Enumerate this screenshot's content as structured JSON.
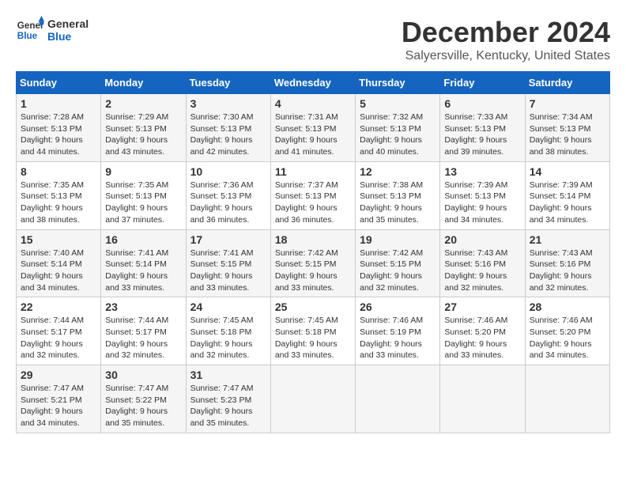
{
  "logo": {
    "line1": "General",
    "line2": "Blue"
  },
  "title": "December 2024",
  "location": "Salyersville, Kentucky, United States",
  "days_of_week": [
    "Sunday",
    "Monday",
    "Tuesday",
    "Wednesday",
    "Thursday",
    "Friday",
    "Saturday"
  ],
  "weeks": [
    [
      {
        "day": "1",
        "sunrise": "7:28 AM",
        "sunset": "5:13 PM",
        "daylight": "9 hours and 44 minutes."
      },
      {
        "day": "2",
        "sunrise": "7:29 AM",
        "sunset": "5:13 PM",
        "daylight": "9 hours and 43 minutes."
      },
      {
        "day": "3",
        "sunrise": "7:30 AM",
        "sunset": "5:13 PM",
        "daylight": "9 hours and 42 minutes."
      },
      {
        "day": "4",
        "sunrise": "7:31 AM",
        "sunset": "5:13 PM",
        "daylight": "9 hours and 41 minutes."
      },
      {
        "day": "5",
        "sunrise": "7:32 AM",
        "sunset": "5:13 PM",
        "daylight": "9 hours and 40 minutes."
      },
      {
        "day": "6",
        "sunrise": "7:33 AM",
        "sunset": "5:13 PM",
        "daylight": "9 hours and 39 minutes."
      },
      {
        "day": "7",
        "sunrise": "7:34 AM",
        "sunset": "5:13 PM",
        "daylight": "9 hours and 38 minutes."
      }
    ],
    [
      {
        "day": "8",
        "sunrise": "7:35 AM",
        "sunset": "5:13 PM",
        "daylight": "9 hours and 38 minutes."
      },
      {
        "day": "9",
        "sunrise": "7:35 AM",
        "sunset": "5:13 PM",
        "daylight": "9 hours and 37 minutes."
      },
      {
        "day": "10",
        "sunrise": "7:36 AM",
        "sunset": "5:13 PM",
        "daylight": "9 hours and 36 minutes."
      },
      {
        "day": "11",
        "sunrise": "7:37 AM",
        "sunset": "5:13 PM",
        "daylight": "9 hours and 36 minutes."
      },
      {
        "day": "12",
        "sunrise": "7:38 AM",
        "sunset": "5:13 PM",
        "daylight": "9 hours and 35 minutes."
      },
      {
        "day": "13",
        "sunrise": "7:39 AM",
        "sunset": "5:13 PM",
        "daylight": "9 hours and 34 minutes."
      },
      {
        "day": "14",
        "sunrise": "7:39 AM",
        "sunset": "5:14 PM",
        "daylight": "9 hours and 34 minutes."
      }
    ],
    [
      {
        "day": "15",
        "sunrise": "7:40 AM",
        "sunset": "5:14 PM",
        "daylight": "9 hours and 34 minutes."
      },
      {
        "day": "16",
        "sunrise": "7:41 AM",
        "sunset": "5:14 PM",
        "daylight": "9 hours and 33 minutes."
      },
      {
        "day": "17",
        "sunrise": "7:41 AM",
        "sunset": "5:15 PM",
        "daylight": "9 hours and 33 minutes."
      },
      {
        "day": "18",
        "sunrise": "7:42 AM",
        "sunset": "5:15 PM",
        "daylight": "9 hours and 33 minutes."
      },
      {
        "day": "19",
        "sunrise": "7:42 AM",
        "sunset": "5:15 PM",
        "daylight": "9 hours and 32 minutes."
      },
      {
        "day": "20",
        "sunrise": "7:43 AM",
        "sunset": "5:16 PM",
        "daylight": "9 hours and 32 minutes."
      },
      {
        "day": "21",
        "sunrise": "7:43 AM",
        "sunset": "5:16 PM",
        "daylight": "9 hours and 32 minutes."
      }
    ],
    [
      {
        "day": "22",
        "sunrise": "7:44 AM",
        "sunset": "5:17 PM",
        "daylight": "9 hours and 32 minutes."
      },
      {
        "day": "23",
        "sunrise": "7:44 AM",
        "sunset": "5:17 PM",
        "daylight": "9 hours and 32 minutes."
      },
      {
        "day": "24",
        "sunrise": "7:45 AM",
        "sunset": "5:18 PM",
        "daylight": "9 hours and 32 minutes."
      },
      {
        "day": "25",
        "sunrise": "7:45 AM",
        "sunset": "5:18 PM",
        "daylight": "9 hours and 33 minutes."
      },
      {
        "day": "26",
        "sunrise": "7:46 AM",
        "sunset": "5:19 PM",
        "daylight": "9 hours and 33 minutes."
      },
      {
        "day": "27",
        "sunrise": "7:46 AM",
        "sunset": "5:20 PM",
        "daylight": "9 hours and 33 minutes."
      },
      {
        "day": "28",
        "sunrise": "7:46 AM",
        "sunset": "5:20 PM",
        "daylight": "9 hours and 34 minutes."
      }
    ],
    [
      {
        "day": "29",
        "sunrise": "7:47 AM",
        "sunset": "5:21 PM",
        "daylight": "9 hours and 34 minutes."
      },
      {
        "day": "30",
        "sunrise": "7:47 AM",
        "sunset": "5:22 PM",
        "daylight": "9 hours and 35 minutes."
      },
      {
        "day": "31",
        "sunrise": "7:47 AM",
        "sunset": "5:23 PM",
        "daylight": "9 hours and 35 minutes."
      },
      null,
      null,
      null,
      null
    ]
  ]
}
